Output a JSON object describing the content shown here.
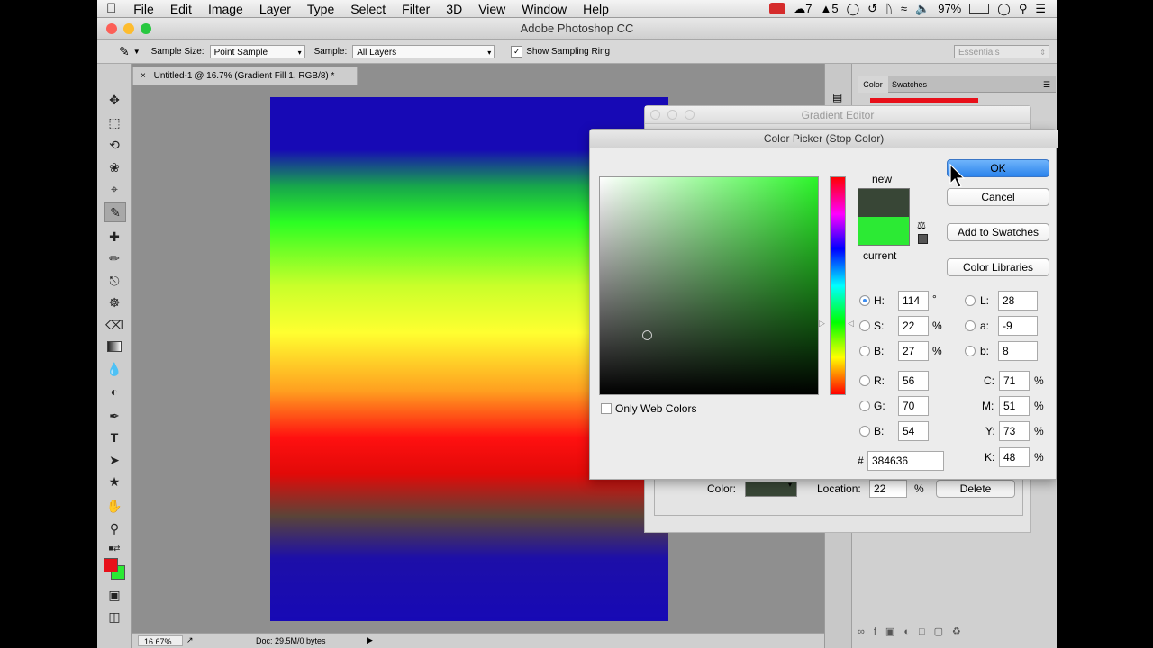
{
  "menubar": {
    "apple": "",
    "items": [
      "File",
      "Edit",
      "Image",
      "Layer",
      "Type",
      "Select",
      "Filter",
      "3D",
      "View",
      "Window",
      "Help"
    ],
    "status": {
      "badge1": "7",
      "badge2": "5",
      "battery": "97%"
    }
  },
  "window": {
    "title": "Adobe Photoshop CC"
  },
  "options": {
    "sample_size_label": "Sample Size:",
    "sample_size_value": "Point Sample",
    "sample_label": "Sample:",
    "sample_value": "All Layers",
    "show_ring": "Show Sampling Ring",
    "workspace": "Essentials"
  },
  "document": {
    "tab_title": "Untitled-1 @ 16.7% (Gradient Fill 1, RGB/8) *",
    "zoom": "16.67%",
    "doc_info": "Doc: 29.5M/0 bytes"
  },
  "panels": {
    "color_tab": "Color",
    "swatches_tab": "Swatches"
  },
  "gradient_editor": {
    "title": "Gradient Editor",
    "color_label": "Color:",
    "location_label": "Location:",
    "location_value": "22",
    "percent": "%",
    "delete_label": "Delete"
  },
  "picker": {
    "title": "Color Picker (Stop Color)",
    "new_label": "new",
    "current_label": "current",
    "new_color": "#384636",
    "current_color": "#2cea34",
    "ok": "OK",
    "cancel": "Cancel",
    "add_swatches": "Add to Swatches",
    "libraries": "Color Libraries",
    "only_web": "Only Web Colors",
    "hsb": [
      {
        "label": "H:",
        "value": "114",
        "unit": "°",
        "checked": true
      },
      {
        "label": "S:",
        "value": "22",
        "unit": "%"
      },
      {
        "label": "B:",
        "value": "27",
        "unit": "%"
      }
    ],
    "rgb": [
      {
        "label": "R:",
        "value": "56"
      },
      {
        "label": "G:",
        "value": "70"
      },
      {
        "label": "B:",
        "value": "54"
      }
    ],
    "lab": [
      {
        "label": "L:",
        "value": "28"
      },
      {
        "label": "a:",
        "value": "-9"
      },
      {
        "label": "b:",
        "value": "8"
      }
    ],
    "cmyk": [
      {
        "label": "C:",
        "value": "71",
        "unit": "%"
      },
      {
        "label": "M:",
        "value": "51",
        "unit": "%"
      },
      {
        "label": "Y:",
        "value": "73",
        "unit": "%"
      },
      {
        "label": "K:",
        "value": "48",
        "unit": "%"
      }
    ],
    "hex_label": "#",
    "hex": "384636"
  }
}
